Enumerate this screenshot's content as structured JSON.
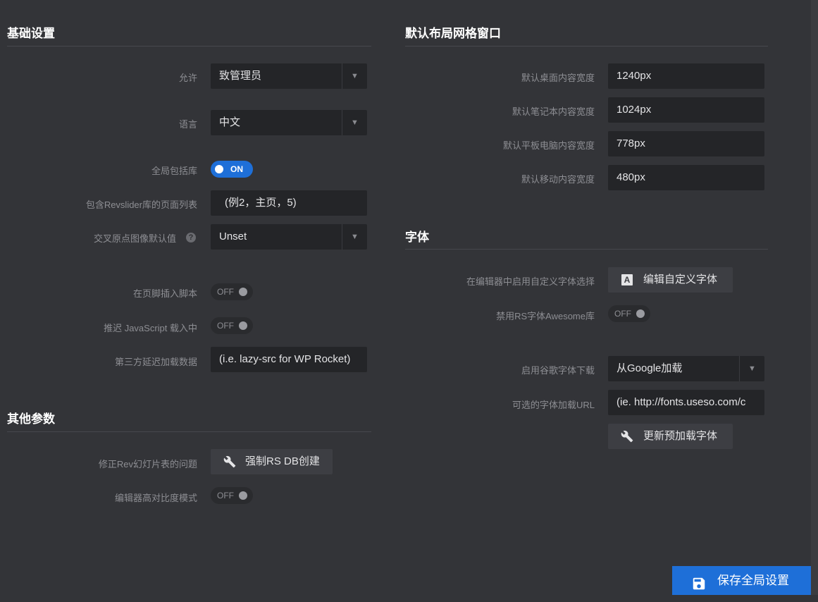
{
  "basic": {
    "title": "基础设置",
    "allow_label": "允许",
    "allow_value": "致管理员",
    "language_label": "语言",
    "language_value": "中文",
    "global_include_label": "全局包括库",
    "global_include_state": "ON",
    "page_list_label": "包含Revslider库的页面列表",
    "page_list_placeholder": "(例2，主页，5)",
    "crossorigin_label": "交叉原点图像默认值",
    "crossorigin_value": "Unset",
    "footer_script_label": "在页脚插入脚本",
    "footer_script_state": "OFF",
    "defer_js_label": "推迟 JavaScript 载入中",
    "defer_js_state": "OFF",
    "third_party_label": "第三方延迟加载数据",
    "third_party_value": "(i.e. lazy-src for WP Rocket)"
  },
  "other": {
    "title": "其他参数",
    "fix_table_label": "修正Rev幻灯片表的问题",
    "fix_table_button": "强制RS DB创建",
    "high_contrast_label": "编辑器高对比度模式",
    "high_contrast_state": "OFF"
  },
  "grid": {
    "title": "默认布局网格窗口",
    "desktop_label": "默认桌面内容宽度",
    "desktop_value": "1240px",
    "notebook_label": "默认笔记本内容宽度",
    "notebook_value": "1024px",
    "tablet_label": "默认平板电脑内容宽度",
    "tablet_value": "778px",
    "mobile_label": "默认移动内容宽度",
    "mobile_value": "480px"
  },
  "fonts": {
    "title": "字体",
    "custom_font_label": "在编辑器中启用自定义字体选择",
    "custom_font_button": "编辑自定义字体",
    "disable_awesome_label": "禁用RS字体Awesome库",
    "disable_awesome_state": "OFF",
    "google_download_label": "启用谷歌字体下载",
    "google_download_value": "从Google加载",
    "font_url_label": "可选的字体加载URL",
    "font_url_placeholder": "(ie. http://fonts.useso.com/c",
    "update_preload_button": "更新预加载字体"
  },
  "footer": {
    "save_button": "保存全局设置"
  },
  "colors": {
    "background": "#333438",
    "field": "#242528",
    "accent": "#1e6fd8"
  }
}
